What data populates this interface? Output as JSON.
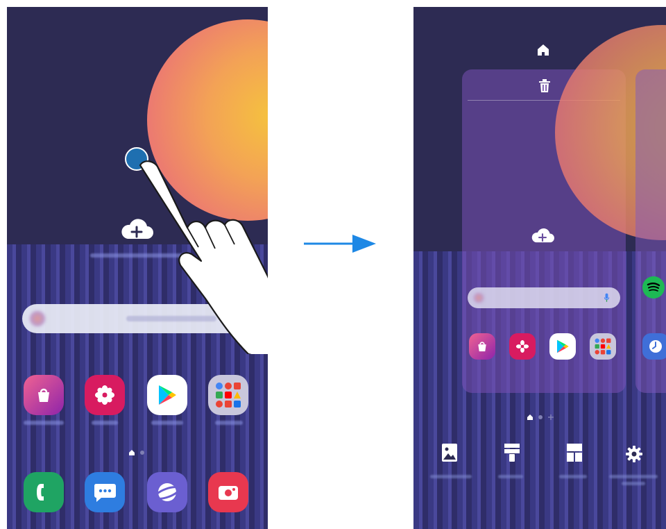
{
  "colors": {
    "wallpaper": "#2d2b53",
    "accent_arrow": "#1e88e5",
    "touch_dot": "#1f6fb0",
    "galaxy_store": "#c2185b",
    "gallery": "#d81b60",
    "play_store": "#ffffff",
    "google_folder": "#c9c7dc",
    "phone": "#1fa463",
    "messages": "#2e7de0",
    "internet": "#6b5fd1",
    "camera": "#e8384f",
    "spotify": "#1db954",
    "clock": "#3f6fd8"
  },
  "left_screen": {
    "icons": [
      "cloud-plus-icon",
      "google-icon",
      "mic-icon",
      "galaxy-store-icon",
      "gallery-icon",
      "play-store-icon",
      "google-folder-icon",
      "phone-icon",
      "messages-icon",
      "internet-icon",
      "camera-icon",
      "hand-pointer-icon"
    ]
  },
  "right_screen": {
    "icons": [
      "home-icon",
      "trash-icon",
      "cloud-plus-icon",
      "mic-icon",
      "spotify-icon",
      "clock-icon",
      "wallpapers-icon",
      "themes-icon",
      "widgets-icon",
      "settings-icon"
    ]
  }
}
